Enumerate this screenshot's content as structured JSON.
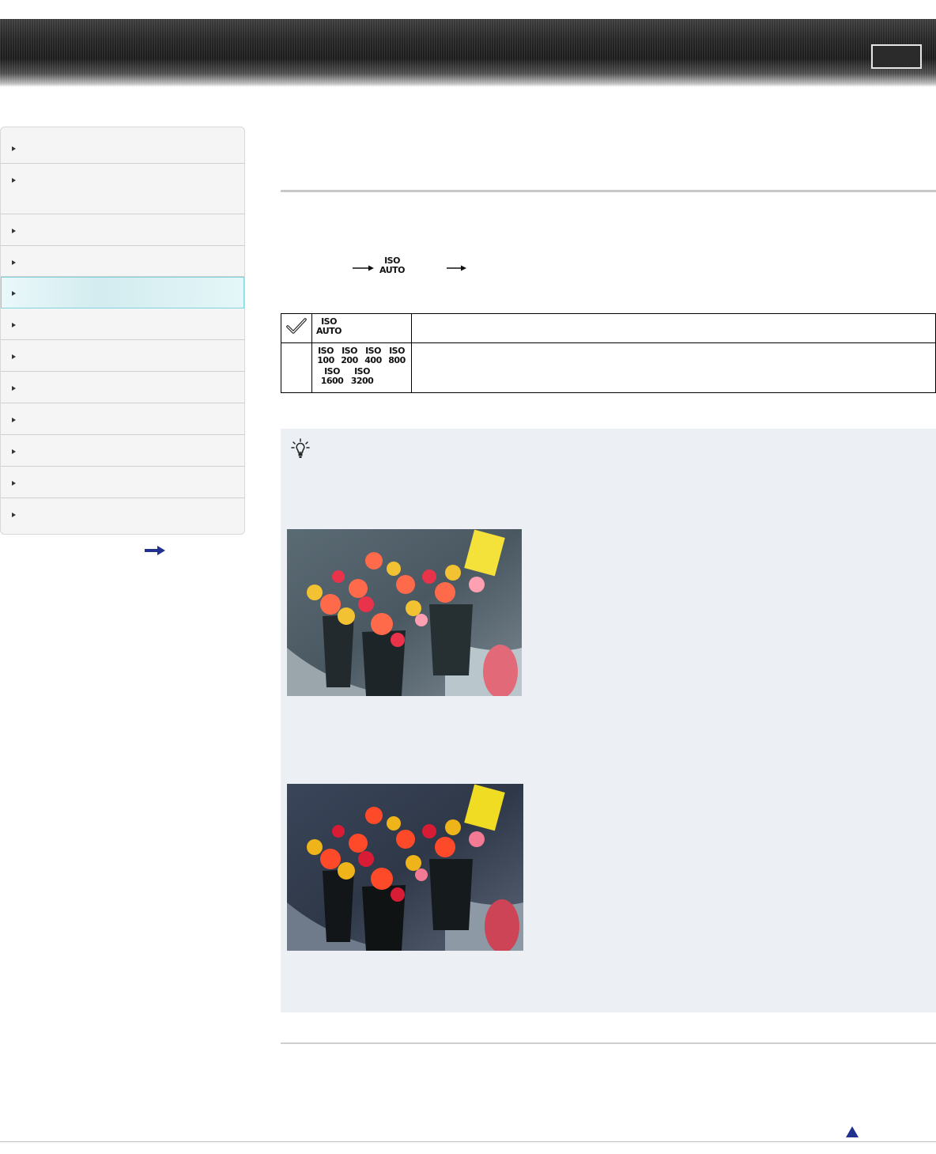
{
  "header": {
    "icon": "banner-button"
  },
  "sidebar": {
    "items": [
      {
        "label": "",
        "icon": "triangle-right-icon"
      },
      {
        "label": "",
        "icon": "triangle-right-icon"
      },
      {
        "label": "",
        "icon": "triangle-right-icon"
      },
      {
        "label": "",
        "icon": "triangle-right-icon"
      },
      {
        "label": "",
        "icon": "triangle-right-icon",
        "selected": true
      },
      {
        "label": "",
        "icon": "triangle-right-icon"
      },
      {
        "label": "",
        "icon": "triangle-right-icon"
      },
      {
        "label": "",
        "icon": "triangle-right-icon"
      },
      {
        "label": "",
        "icon": "triangle-right-icon"
      },
      {
        "label": "",
        "icon": "triangle-right-icon"
      },
      {
        "label": "",
        "icon": "triangle-right-icon"
      },
      {
        "label": "",
        "icon": "triangle-right-icon"
      }
    ],
    "more_icon": "arrow-right-icon"
  },
  "menu_path": {
    "iso_icon_top": "ISO",
    "iso_icon_bottom": "AUTO"
  },
  "options_table": {
    "rows": [
      {
        "checked": true,
        "icon_lines": [
          [
            "ISO",
            "AUTO"
          ]
        ],
        "description": ""
      },
      {
        "checked": false,
        "icon_lines": [
          [
            "ISO",
            "ISO",
            "ISO",
            "ISO"
          ],
          [
            "100",
            "200",
            "400",
            "800"
          ],
          [
            "ISO",
            "ISO"
          ],
          [
            "1600",
            "3200"
          ]
        ],
        "description": ""
      }
    ]
  },
  "hint": {
    "icon": "lightbulb-icon",
    "images": [
      {
        "name": "flowers-photo-bright"
      },
      {
        "name": "flowers-photo-dark"
      }
    ]
  },
  "footer": {
    "page_top_icon": "triangle-up-icon"
  },
  "colors": {
    "nav_active_border": "#7fd3de",
    "nav_active_bg": "#d3ecef",
    "hint_bg": "#ecf0f5",
    "arrow_blue": "#22318c"
  }
}
